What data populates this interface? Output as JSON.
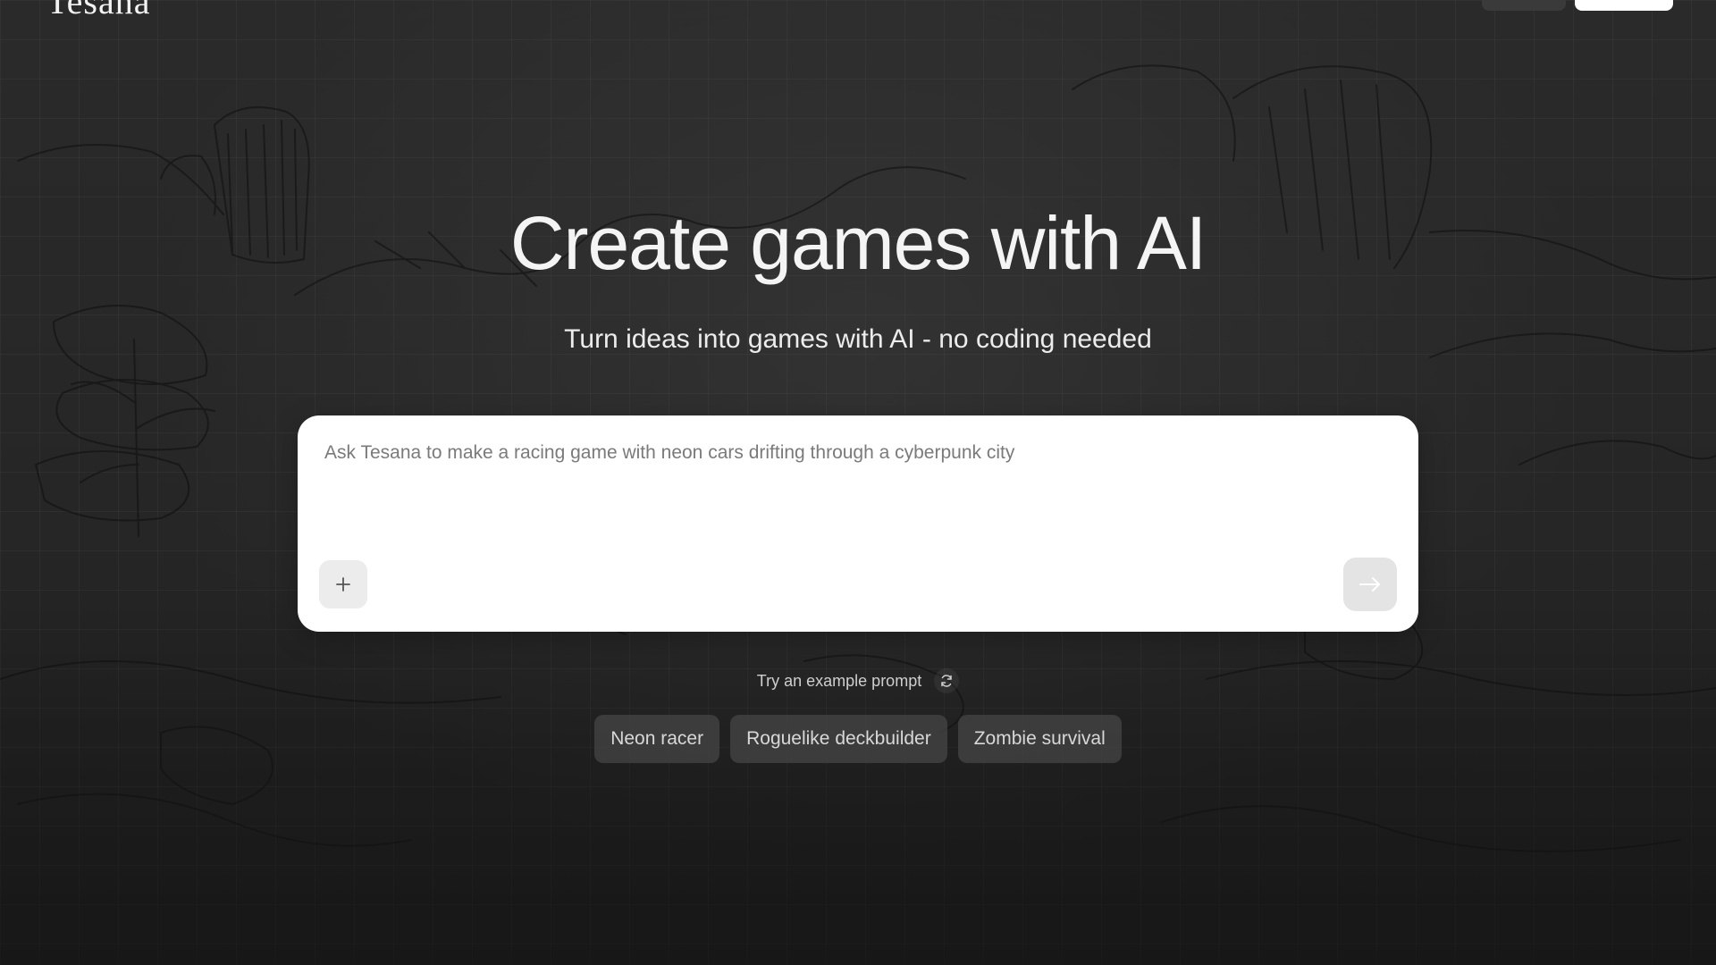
{
  "header": {
    "logo_text": "Tesana",
    "secondary_button_label": "",
    "primary_button_label": ""
  },
  "hero": {
    "title": "Create games with AI",
    "subtitle": "Turn ideas into games with AI - no coding needed"
  },
  "prompt": {
    "placeholder": "Ask Tesana to make a racing game with neon cars drifting through a cyberpunk city",
    "value": "",
    "add_icon": "plus-icon",
    "send_icon": "arrow-right-icon"
  },
  "examples": {
    "label": "Try an example prompt",
    "refresh_icon": "refresh-icon",
    "chips": [
      {
        "label": "Neon racer"
      },
      {
        "label": "Roguelike deckbuilder"
      },
      {
        "label": "Zombie survival"
      }
    ]
  },
  "colors": {
    "background": "#262626",
    "prompt_box": "#ffffff",
    "chip_background": "#464646",
    "text_primary": "#f4f4f4"
  }
}
